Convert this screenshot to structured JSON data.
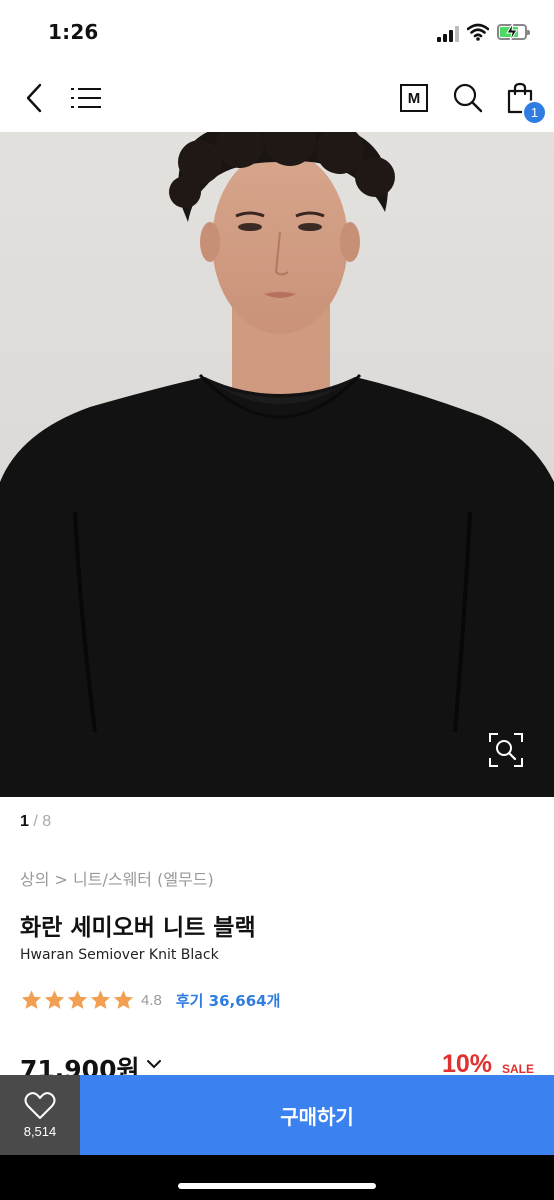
{
  "status_bar": {
    "time": "1:26"
  },
  "nav": {
    "back_icon": "chevron-left-icon",
    "menu_icon": "hamburger-icon",
    "mall_label": "M",
    "search_icon": "search-icon",
    "cart_icon": "shopping-bag-icon",
    "cart_count": "1"
  },
  "gallery": {
    "current": "1",
    "separator": " / ",
    "total": "8",
    "zoom_icon": "zoom-icon"
  },
  "product": {
    "breadcrumb": "상의 > 니트/스웨터 (엘무드)",
    "name_ko": "화란 세미오버 니트 블랙",
    "name_en": "Hwaran Semiover Knit Black",
    "rating": "4.8",
    "stars": 5,
    "review_text": "후기 36,664개",
    "price": "71,900원",
    "discount": "10%",
    "sale_label": "SALE"
  },
  "bottom": {
    "like_icon": "heart-icon",
    "like_count": "8,514",
    "buy_label": "구매하기"
  },
  "colors": {
    "accent": "#3b82f0",
    "link": "#2f7de1",
    "sale": "#e03030",
    "star": "#f0a050",
    "like_bg": "#4a4a4a"
  }
}
